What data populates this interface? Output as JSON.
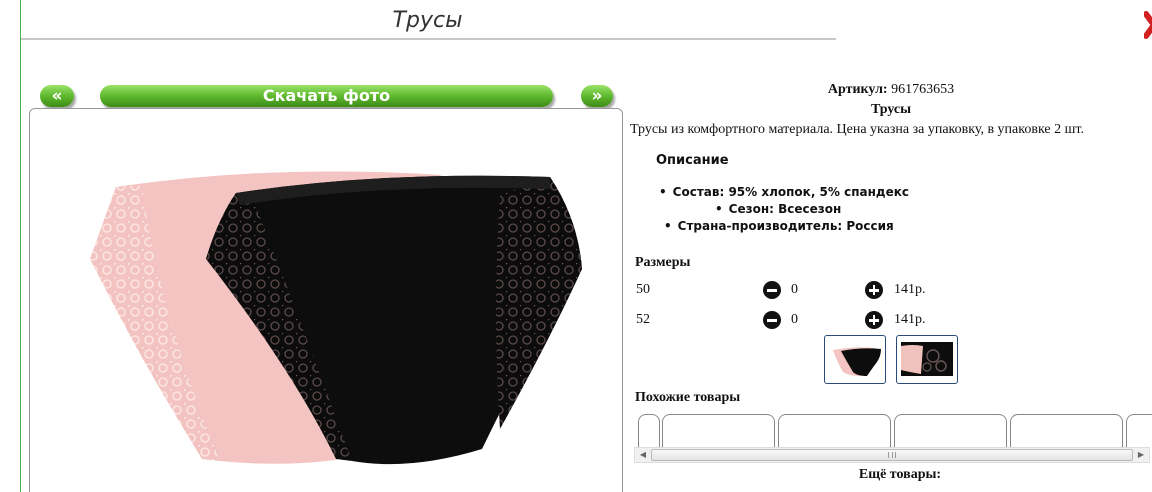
{
  "header": {
    "title": "Трусы"
  },
  "photo_nav": {
    "prev_label": "«",
    "download_label": "Скачать фото",
    "next_label": "»"
  },
  "product": {
    "sku_label": "Артикул:",
    "sku_value": "961763653",
    "name": "Трусы",
    "description": "Трусы из комфортного материала. Цена указна за упаковку, в упаковке 2 шт."
  },
  "description_section": {
    "heading": "Описание",
    "features": [
      "Состав: 95% хлопок, 5% спандекс",
      "Сезон: Всесезон",
      "Страна-производитель: Россия"
    ]
  },
  "sizes": {
    "heading": "Размеры",
    "rows": [
      {
        "size": "50",
        "qty": "0",
        "price": "141р."
      },
      {
        "size": "52",
        "qty": "0",
        "price": "141р."
      }
    ]
  },
  "similar": {
    "heading": "Похожие товары"
  },
  "more": {
    "heading": "Ещё товары:"
  },
  "colors": {
    "accent_green": "#5fb92e",
    "thumb_border": "#2b4a7a",
    "link_green": "#2a7a1a"
  },
  "icons": {
    "close": "close-x-icon",
    "minus": "minus-circle-icon",
    "plus": "plus-circle-icon"
  }
}
